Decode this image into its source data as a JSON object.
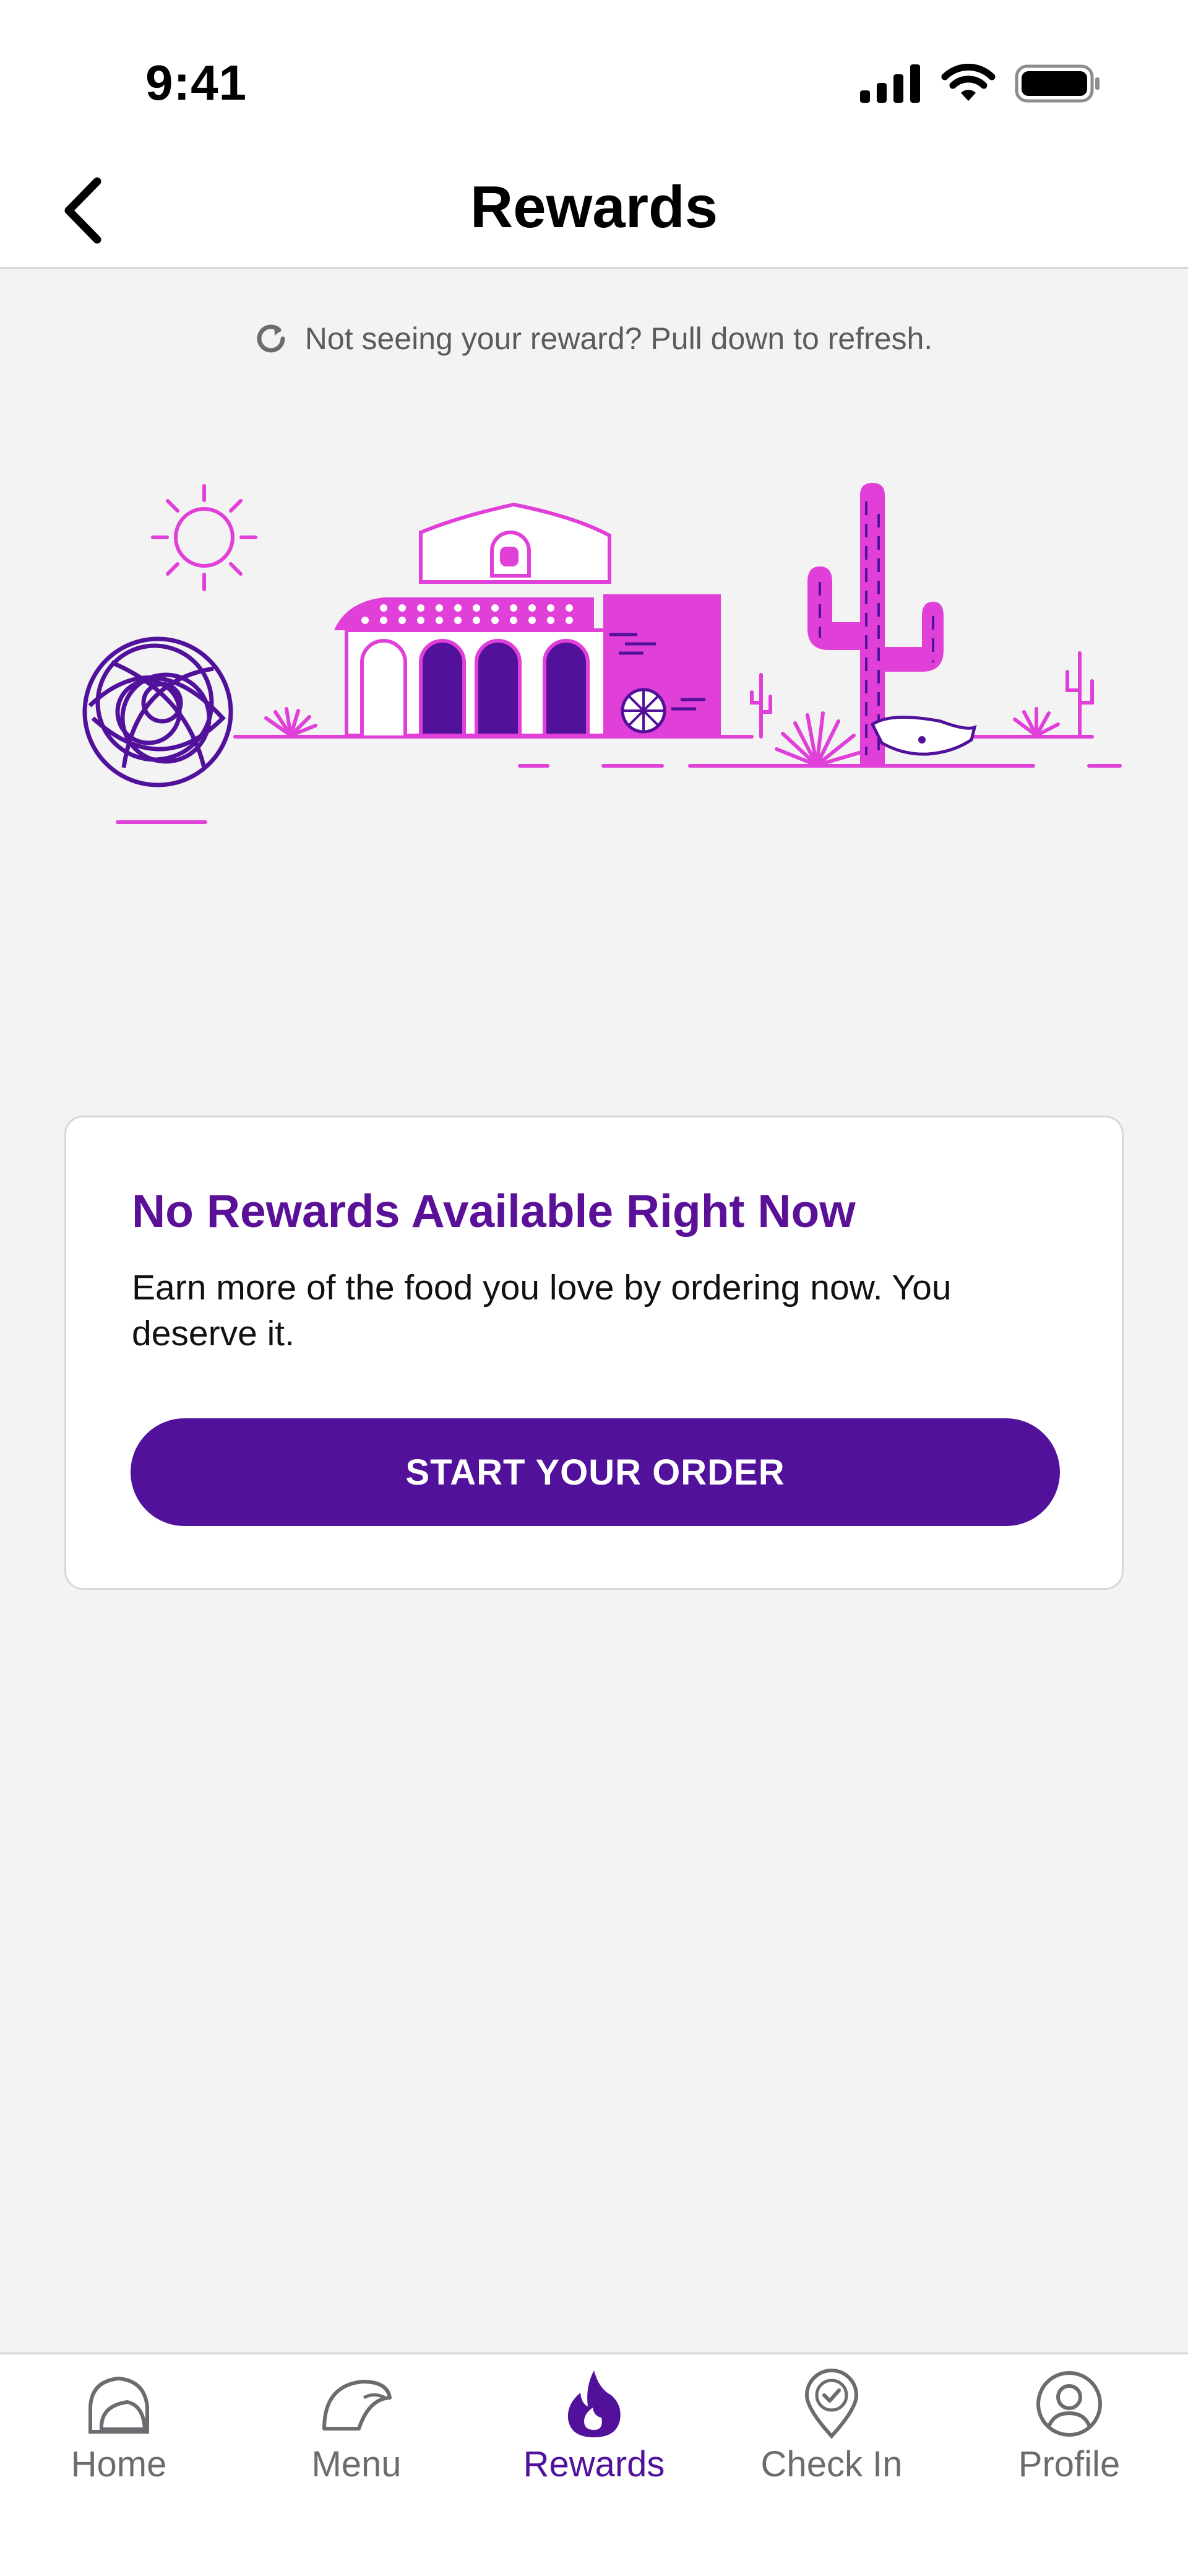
{
  "status_bar": {
    "time": "9:41"
  },
  "nav": {
    "title": "Rewards",
    "back_icon": "chevron-left-icon"
  },
  "refresh_hint": {
    "text": "Not seeing your reward? Pull down to refresh.",
    "icon": "refresh-icon"
  },
  "card": {
    "title": "No Rewards Available Right Now",
    "body": "Earn more of the food you love by ordering now. You deserve it.",
    "cta_label": "START YOUR ORDER"
  },
  "tabs": [
    {
      "label": "Home",
      "icon": "bell-taco-icon",
      "active": false
    },
    {
      "label": "Menu",
      "icon": "taco-icon",
      "active": false
    },
    {
      "label": "Rewards",
      "icon": "flame-icon",
      "active": true
    },
    {
      "label": "Check In",
      "icon": "location-check-icon",
      "active": false
    },
    {
      "label": "Profile",
      "icon": "profile-icon",
      "active": false
    }
  ],
  "colors": {
    "brand_purple": "#52119b",
    "title_purple": "#5a1197",
    "illustration_pink": "#e03fd8",
    "background": "#f3f3f4"
  }
}
